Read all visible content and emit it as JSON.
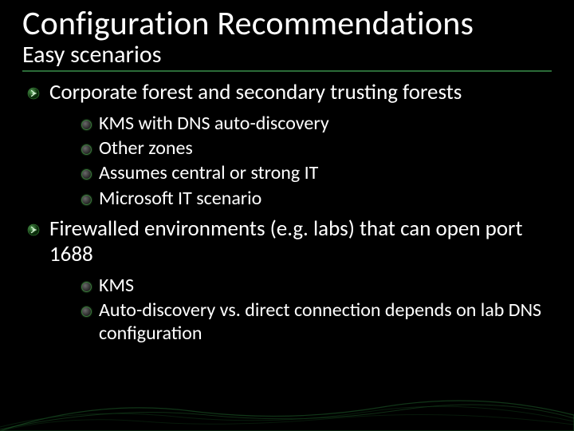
{
  "title": "Configuration Recommendations",
  "subtitle": "Easy scenarios",
  "sections": [
    {
      "heading": "Corporate forest and secondary trusting forests",
      "items": [
        "KMS with DNS auto-discovery",
        "Other zones",
        "Assumes central or strong IT",
        "Microsoft IT scenario"
      ]
    },
    {
      "heading": "Firewalled environments (e.g. labs) that can open port 1688",
      "items": [
        "KMS",
        "Auto-discovery vs. direct connection depends on lab DNS configuration"
      ]
    }
  ],
  "accent_color": "#2b7a3a"
}
